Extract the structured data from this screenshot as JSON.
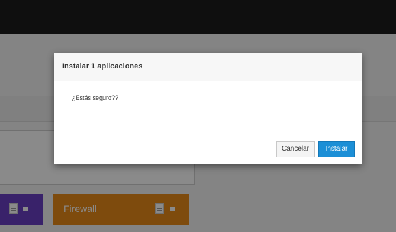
{
  "modal": {
    "title": "Instalar 1 aplicaciones",
    "message": "¿Estás seguro??",
    "cancel_label": "Cancelar",
    "install_label": "Instalar"
  },
  "tiles": [
    {
      "label": "",
      "color": "#6a3fc4"
    },
    {
      "label": "Firewall",
      "color": "#e98b18"
    }
  ],
  "colors": {
    "topbar": "#1c1c1c",
    "primary_button": "#1c8fd6",
    "overlay": "rgba(0,0,0,0.46)"
  },
  "icons": [
    "document-icon",
    "square-icon"
  ]
}
